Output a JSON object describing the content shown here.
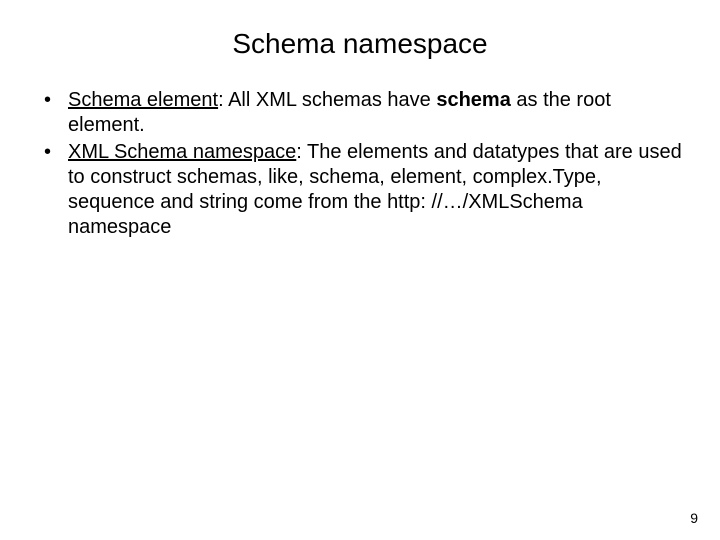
{
  "title": "Schema namespace",
  "bullets": [
    {
      "term": "Schema element",
      "colon": ": ",
      "before_bold": "All XML schemas have ",
      "bold": "schema",
      "after_bold": " as the root element."
    },
    {
      "term": "XML Schema namespace",
      "colon": ": ",
      "before_bold": "The elements and datatypes that are used to construct schemas, like, schema, element, complex.Type, sequence and string come from the http: //…/XMLSchema namespace",
      "bold": "",
      "after_bold": ""
    }
  ],
  "page_number": "9"
}
